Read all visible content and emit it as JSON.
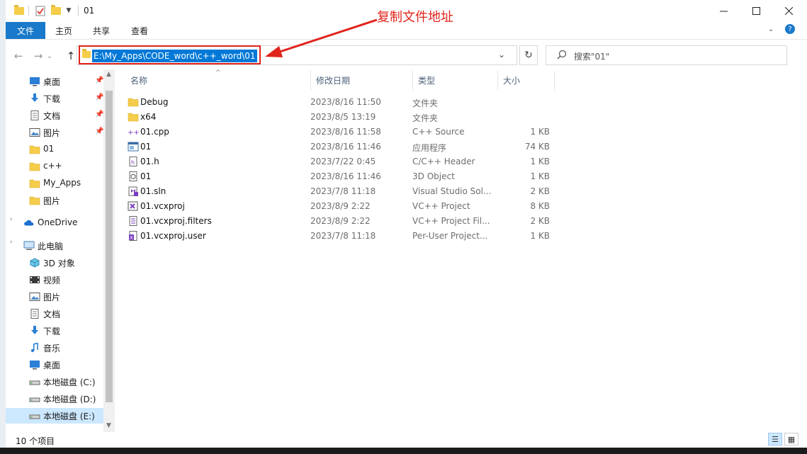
{
  "window": {
    "title": "01"
  },
  "ribbon": {
    "tabs": [
      "文件",
      "主页",
      "共享",
      "查看"
    ]
  },
  "address": {
    "path": "E:\\My_Apps\\CODE_word\\c++_word\\01"
  },
  "search": {
    "placeholder": "搜索\"01\""
  },
  "annotation": {
    "text": "复制文件地址",
    "color": "#e0231b"
  },
  "columns": {
    "name": "名称",
    "date": "修改日期",
    "type": "类型",
    "size": "大小"
  },
  "sidebar": [
    {
      "label": "桌面",
      "icon": "desktop-icon",
      "pinned": true
    },
    {
      "label": "下载",
      "icon": "download-icon",
      "pinned": true
    },
    {
      "label": "文档",
      "icon": "document-icon",
      "pinned": true
    },
    {
      "label": "图片",
      "icon": "picture-icon",
      "pinned": true
    },
    {
      "label": "01",
      "icon": "folder-icon",
      "pinned": false
    },
    {
      "label": "c++",
      "icon": "folder-icon",
      "pinned": false
    },
    {
      "label": "My_Apps",
      "icon": "folder-icon",
      "pinned": false
    },
    {
      "label": "图片",
      "icon": "folder-icon",
      "pinned": false
    },
    {
      "label": "OneDrive",
      "icon": "onedrive-icon",
      "pinned": false
    },
    {
      "label": "此电脑",
      "icon": "computer-icon",
      "pinned": false
    },
    {
      "label": "3D 对象",
      "icon": "3d-objects-icon",
      "pinned": false
    },
    {
      "label": "视频",
      "icon": "video-icon",
      "pinned": false
    },
    {
      "label": "图片",
      "icon": "picture-icon",
      "pinned": false
    },
    {
      "label": "文档",
      "icon": "document-icon",
      "pinned": false
    },
    {
      "label": "下载",
      "icon": "download-icon",
      "pinned": false
    },
    {
      "label": "音乐",
      "icon": "music-icon",
      "pinned": false
    },
    {
      "label": "桌面",
      "icon": "desktop-icon",
      "pinned": false
    },
    {
      "label": "本地磁盘 (C:)",
      "icon": "drive-icon",
      "pinned": false
    },
    {
      "label": "本地磁盘 (D:)",
      "icon": "drive-icon",
      "pinned": false
    },
    {
      "label": "本地磁盘 (E:)",
      "icon": "drive-icon",
      "pinned": false,
      "selected": true
    }
  ],
  "files": [
    {
      "name": "Debug",
      "date": "2023/8/16 11:50",
      "type": "文件夹",
      "size": "",
      "icon": "folder-icon"
    },
    {
      "name": "x64",
      "date": "2023/8/5 13:19",
      "type": "文件夹",
      "size": "",
      "icon": "folder-icon"
    },
    {
      "name": "01.cpp",
      "date": "2023/8/16 11:58",
      "type": "C++ Source",
      "size": "1 KB",
      "icon": "cpp-file-icon"
    },
    {
      "name": "01",
      "date": "2023/8/16 11:46",
      "type": "应用程序",
      "size": "74 KB",
      "icon": "exe-icon"
    },
    {
      "name": "01.h",
      "date": "2023/7/22 0:45",
      "type": "C/C++ Header",
      "size": "1 KB",
      "icon": "header-file-icon"
    },
    {
      "name": "01",
      "date": "2023/8/16 11:46",
      "type": "3D Object",
      "size": "1 KB",
      "icon": "3d-object-file-icon"
    },
    {
      "name": "01.sln",
      "date": "2023/7/8 11:18",
      "type": "Visual Studio Sol...",
      "size": "2 KB",
      "icon": "sln-file-icon"
    },
    {
      "name": "01.vcxproj",
      "date": "2023/8/9 2:22",
      "type": "VC++ Project",
      "size": "8 KB",
      "icon": "vcxproj-file-icon"
    },
    {
      "name": "01.vcxproj.filters",
      "date": "2023/8/9 2:22",
      "type": "VC++ Project Fil...",
      "size": "2 KB",
      "icon": "filters-file-icon"
    },
    {
      "name": "01.vcxproj.user",
      "date": "2023/7/8 11:18",
      "type": "Per-User Project...",
      "size": "1 KB",
      "icon": "user-file-icon"
    }
  ],
  "status": {
    "count": "10 个项目"
  }
}
